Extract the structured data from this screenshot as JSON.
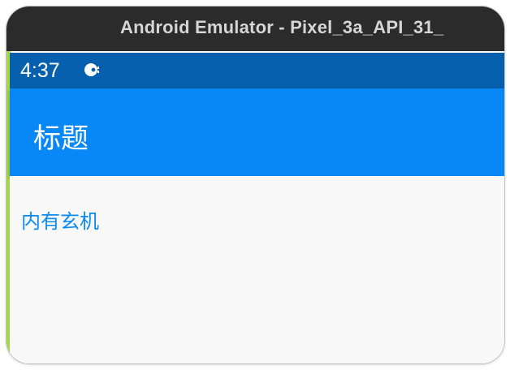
{
  "window": {
    "title": "Android Emulator - Pixel_3a_API_31_"
  },
  "status_bar": {
    "time": "4:37",
    "icon": "tweak-icon"
  },
  "app_bar": {
    "title": "标题"
  },
  "content": {
    "link_text": "内有玄机"
  },
  "colors": {
    "title_bar": "#2b2b2b",
    "status_bar": "#0760ad",
    "app_bar": "#0888f6",
    "link": "#0a8af1",
    "background": "#f8f8f8"
  }
}
